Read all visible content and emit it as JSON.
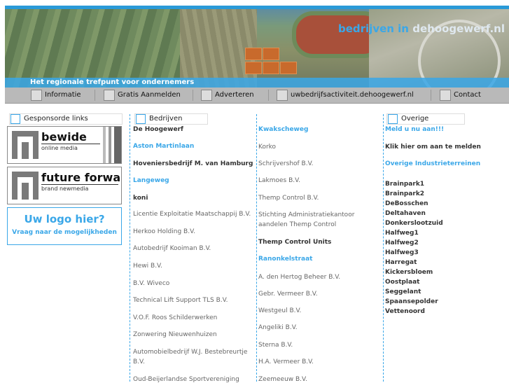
{
  "header": {
    "title_prefix": "bedrijven in",
    "title_domain": "dehoogewerf.nl",
    "tagline": "Het regionale trefpunt voor ondernemers"
  },
  "nav": [
    {
      "label": "Informatie"
    },
    {
      "label": "Gratis Aanmelden"
    },
    {
      "label": "Adverteren"
    },
    {
      "label": "uwbedrijfsactiviteit.dehoogewerf.nl"
    },
    {
      "label": "Contact"
    }
  ],
  "sponsored": {
    "heading": "Gesponsorde links",
    "ads": [
      {
        "name": "bewide",
        "sub": "online media"
      },
      {
        "name": "future forward",
        "sub": "brand newmedia"
      }
    ],
    "placeholder": {
      "big": "Uw logo hier?",
      "small": "Vraag naar de mogelijkheden"
    }
  },
  "companies": {
    "heading": "Bedrijven",
    "col1": [
      {
        "text": "De Hoogewerf",
        "style": "b"
      },
      {
        "text": "Aston Martinlaan",
        "style": "l"
      },
      {
        "text": "Hoveniersbedrijf M. van Hamburg",
        "style": "b"
      },
      {
        "text": "Langeweg",
        "style": "l"
      },
      {
        "text": "koni",
        "style": "b"
      },
      {
        "text": "Licentie Exploitatie Maatschappij B.V.",
        "style": "n"
      },
      {
        "text": "Herkoo Holding B.V.",
        "style": "n"
      },
      {
        "text": "Autobedrijf Kooiman B.V.",
        "style": "n"
      },
      {
        "text": "Hewi B.V.",
        "style": "n"
      },
      {
        "text": "B.V. Wiveco",
        "style": "n"
      },
      {
        "text": "Technical Lift Support TLS B.V.",
        "style": "n"
      },
      {
        "text": "V.O.F. Roos Schilderwerken",
        "style": "n"
      },
      {
        "text": "Zonwering Nieuwenhuizen",
        "style": "n"
      },
      {
        "text": "Automobielbedrijf W.J. Bestebreurtje",
        "style": "n"
      },
      {
        "text": "B.V.",
        "style": "n"
      },
      {
        "text": "Oud-Beijerlandse Sportvereniging",
        "style": "n"
      }
    ],
    "col2": [
      {
        "text": "Kwakscheweg",
        "style": "l"
      },
      {
        "text": "Korko",
        "style": "n"
      },
      {
        "text": "Schrijvershof B.V.",
        "style": "n"
      },
      {
        "text": "Lakmoes B.V.",
        "style": "n"
      },
      {
        "text": "Themp Control B.V.",
        "style": "n"
      },
      {
        "text": "Stichting Administratiekantoor",
        "style": "n"
      },
      {
        "text": "aandelen Themp Control",
        "style": "n"
      },
      {
        "text": "Themp Control Units",
        "style": "b"
      },
      {
        "text": "Ranonkelstraat",
        "style": "l"
      },
      {
        "text": "A. den Hertog Beheer B.V.",
        "style": "n"
      },
      {
        "text": "Gebr. Vermeer B.V.",
        "style": "n"
      },
      {
        "text": "Westgeul B.V.",
        "style": "n"
      },
      {
        "text": "Angeliki B.V.",
        "style": "n"
      },
      {
        "text": "Sterna B.V.",
        "style": "n"
      },
      {
        "text": "H.A. Vermeer B.V.",
        "style": "n"
      },
      {
        "text": "Zeemeeuw B.V.",
        "style": "n"
      }
    ]
  },
  "other": {
    "heading": "Overige",
    "items": [
      {
        "text": "Meld u nu aan!!!",
        "style": "l"
      },
      {
        "text": "Klik hier om aan te melden",
        "style": "b"
      },
      {
        "text": "Overige Industrieterreinen",
        "style": "l"
      },
      {
        "text": "Brainpark1",
        "style": "b"
      },
      {
        "text": "Brainpark2",
        "style": "b"
      },
      {
        "text": "DeBosschen",
        "style": "b"
      },
      {
        "text": "Deltahaven",
        "style": "b"
      },
      {
        "text": "Donkerslootzuid",
        "style": "b"
      },
      {
        "text": "Halfweg1",
        "style": "b"
      },
      {
        "text": "Halfweg2",
        "style": "b"
      },
      {
        "text": "Halfweg3",
        "style": "b"
      },
      {
        "text": "Harregat",
        "style": "b"
      },
      {
        "text": "Kickersbloem",
        "style": "b"
      },
      {
        "text": "Oostplaat",
        "style": "b"
      },
      {
        "text": "Seggelant",
        "style": "b"
      },
      {
        "text": "Spaansepolder",
        "style": "b"
      },
      {
        "text": "Vettenoord",
        "style": "b"
      }
    ]
  }
}
